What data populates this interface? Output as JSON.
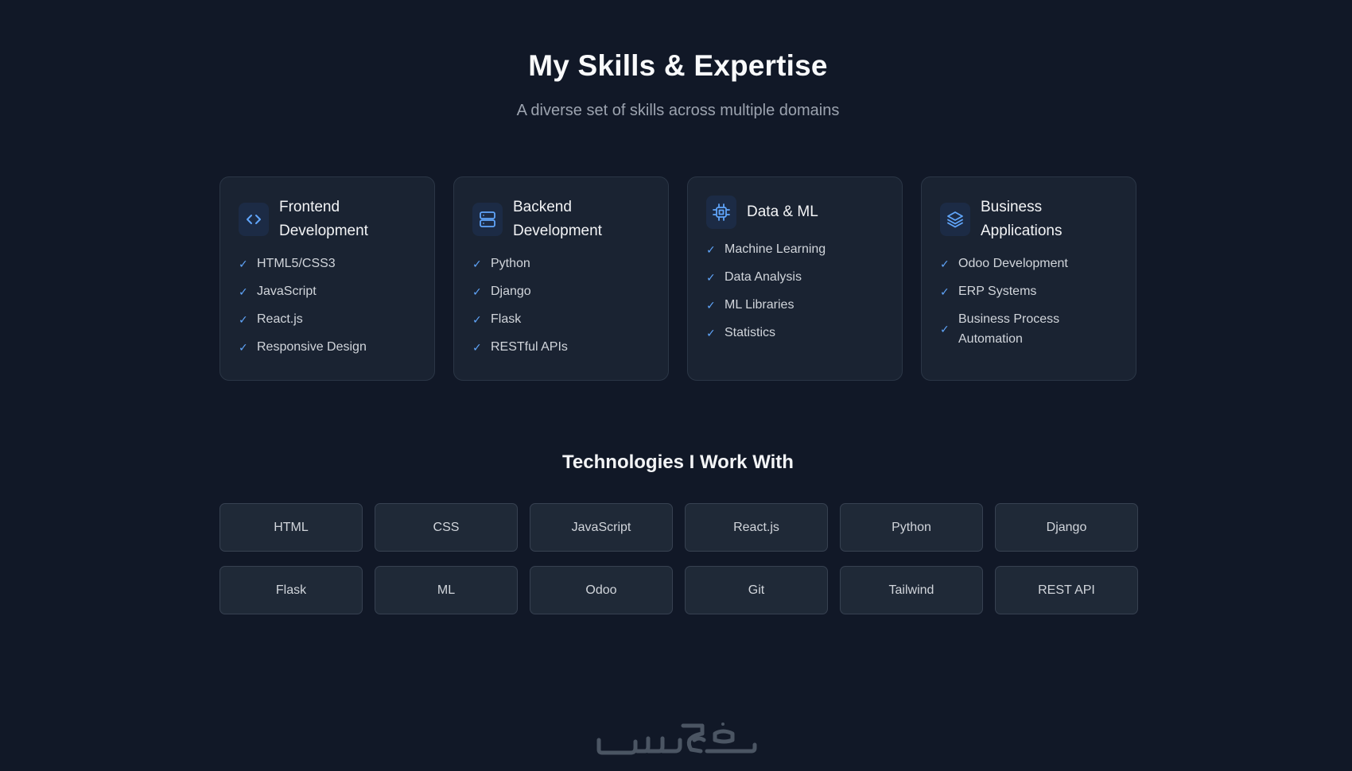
{
  "header": {
    "title": "My Skills & Expertise",
    "subtitle": "A diverse set of skills across multiple domains"
  },
  "skill_cards": [
    {
      "icon": "code-icon",
      "title_line1": "Frontend",
      "title_line2": "Development",
      "items": [
        "HTML5/CSS3",
        "JavaScript",
        "React.js",
        "Responsive Design"
      ]
    },
    {
      "icon": "server-icon",
      "title_line1": "Backend",
      "title_line2": "Development",
      "items": [
        "Python",
        "Django",
        "Flask",
        "RESTful APIs"
      ]
    },
    {
      "icon": "cpu-chip-icon",
      "title_line1": "Data & ML",
      "title_line2": "",
      "items": [
        "Machine Learning",
        "Data Analysis",
        "ML Libraries",
        "Statistics"
      ]
    },
    {
      "icon": "layers-icon",
      "title_line1": "Business",
      "title_line2": "Applications",
      "items": [
        "Odoo Development",
        "ERP Systems",
        "Business Process Automation"
      ]
    }
  ],
  "technologies": {
    "title": "Technologies I Work With",
    "items": [
      "HTML",
      "CSS",
      "JavaScript",
      "React.js",
      "Python",
      "Django",
      "Flask",
      "ML",
      "Odoo",
      "Git",
      "Tailwind",
      "REST API"
    ]
  },
  "colors": {
    "background": "#111827",
    "card_background": "#1a2332",
    "accent": "#60a5fa",
    "chip_background": "#1f2937"
  },
  "watermark": {
    "text": "خمسات"
  }
}
